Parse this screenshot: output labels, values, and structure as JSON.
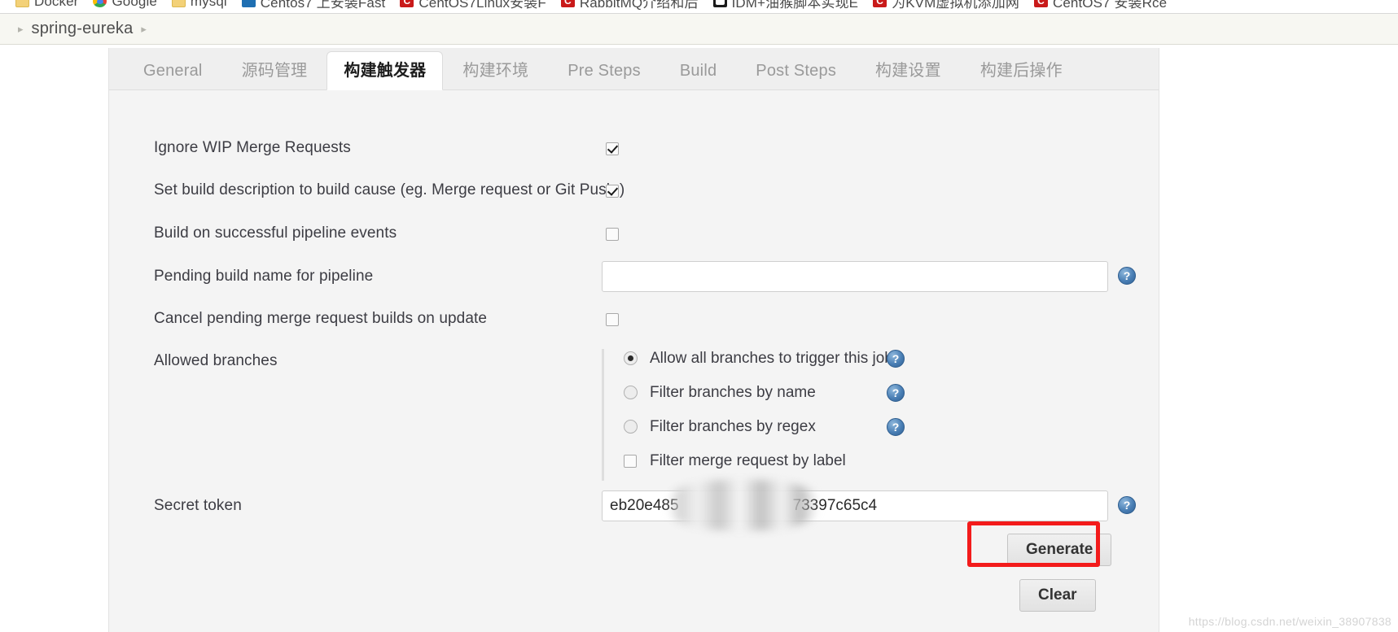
{
  "browser": {
    "bookmarks": [
      {
        "label": "Docker",
        "icon": "folder-icon"
      },
      {
        "label": "Google",
        "icon": "chrome-icon"
      },
      {
        "label": "mysql",
        "icon": "folder-icon"
      },
      {
        "label": "Centos7 上安装Fast",
        "icon": "blue-doc-icon"
      },
      {
        "label": "CentOS7Linux安装F",
        "icon": "csdn-icon"
      },
      {
        "label": "RabbitMQ介绍和后",
        "icon": "csdn-icon"
      },
      {
        "label": "IDM+油猴脚本实现E",
        "icon": "dark-icon"
      },
      {
        "label": "为KVM虚拟机添加网",
        "icon": "csdn-icon"
      },
      {
        "label": "CentOS7 安装Rce",
        "icon": "csdn-icon"
      }
    ]
  },
  "breadcrumb": {
    "leading_chevron": "▸",
    "project": "spring-eureka",
    "trailing_chevron": "▸"
  },
  "tabs": [
    {
      "label": "General",
      "active": false
    },
    {
      "label": "源码管理",
      "active": false
    },
    {
      "label": "构建触发器",
      "active": true
    },
    {
      "label": "构建环境",
      "active": false
    },
    {
      "label": "Pre Steps",
      "active": false
    },
    {
      "label": "Build",
      "active": false
    },
    {
      "label": "Post Steps",
      "active": false
    },
    {
      "label": "构建设置",
      "active": false
    },
    {
      "label": "构建后操作",
      "active": false
    }
  ],
  "form": {
    "ignore_wip": {
      "label": "Ignore WIP Merge Requests",
      "checked": true
    },
    "set_build_description": {
      "label": "Set build description to build cause (eg. Merge request or Git Push )",
      "checked": true
    },
    "build_on_pipeline": {
      "label": "Build on successful pipeline events",
      "checked": false
    },
    "pending_build_name": {
      "label": "Pending build name for pipeline",
      "value": "",
      "help_icon": "help-icon"
    },
    "cancel_pending": {
      "label": "Cancel pending merge request builds on update",
      "checked": false
    },
    "allowed_branches": {
      "label": "Allowed branches",
      "options": [
        {
          "label": "Allow all branches to trigger this job",
          "selected": true,
          "type": "radio",
          "help_icon": "help-icon"
        },
        {
          "label": "Filter branches by name",
          "selected": false,
          "type": "radio",
          "help_icon": "help-icon"
        },
        {
          "label": "Filter branches by regex",
          "selected": false,
          "type": "radio",
          "help_icon": "help-icon"
        },
        {
          "label": "Filter merge request by label",
          "selected": false,
          "type": "checkbox",
          "help_icon": ""
        }
      ]
    },
    "secret_token": {
      "label": "Secret token",
      "value_prefix": "eb20e485",
      "value_suffix": "73397c65c4",
      "help_icon": "help-icon"
    },
    "generate_button": "Generate",
    "clear_button": "Clear"
  },
  "annotation": {
    "color": "#f31b1b",
    "target": "generate-button"
  },
  "watermark": "https://blog.csdn.net/weixin_38907838"
}
